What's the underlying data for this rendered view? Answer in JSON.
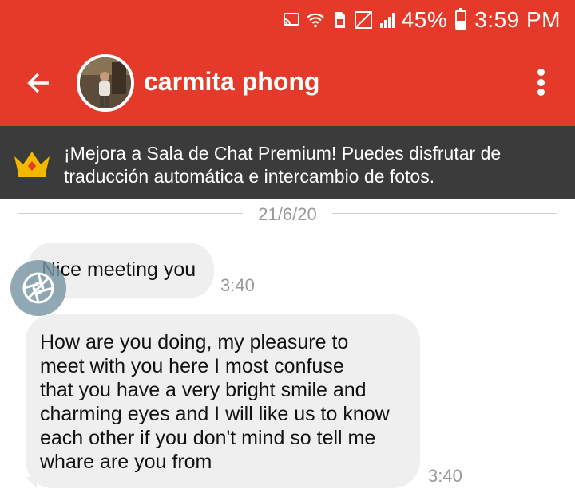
{
  "status_bar": {
    "battery_percent": "45%",
    "battery_level": 0.45,
    "time": "3:59 PM",
    "icons": [
      "cast-icon",
      "wifi-call-icon",
      "sim-icon",
      "no-signal-icon",
      "signal-icon",
      "battery-icon"
    ]
  },
  "header": {
    "contact_name": "carmita phong",
    "back_icon": "arrow-back-icon",
    "menu_icon": "more-vert-icon"
  },
  "premium_banner": {
    "icon": "crown-icon",
    "text": "¡Mejora a Sala de Chat Premium! Puedes disfrutar de traducción automática e intercambio de fotos."
  },
  "date_separator": "21/6/20",
  "messages": [
    {
      "text": "Nice meeting you",
      "time": "3:40"
    },
    {
      "text": "How are you doing,  my pleasure to\nmeet with you here I most confuse\nthat you have a very bright smile and\ncharming eyes and I will like us to know\neach other if you don't mind so tell me\nwhare are you from",
      "time": "3:40"
    }
  ],
  "floating_button": {
    "icon": "camera-shutter-icon"
  },
  "colors": {
    "primary": "#e53a2a",
    "banner": "#3b3b3b",
    "bubble": "#efefef",
    "crown": "#f5b800"
  }
}
